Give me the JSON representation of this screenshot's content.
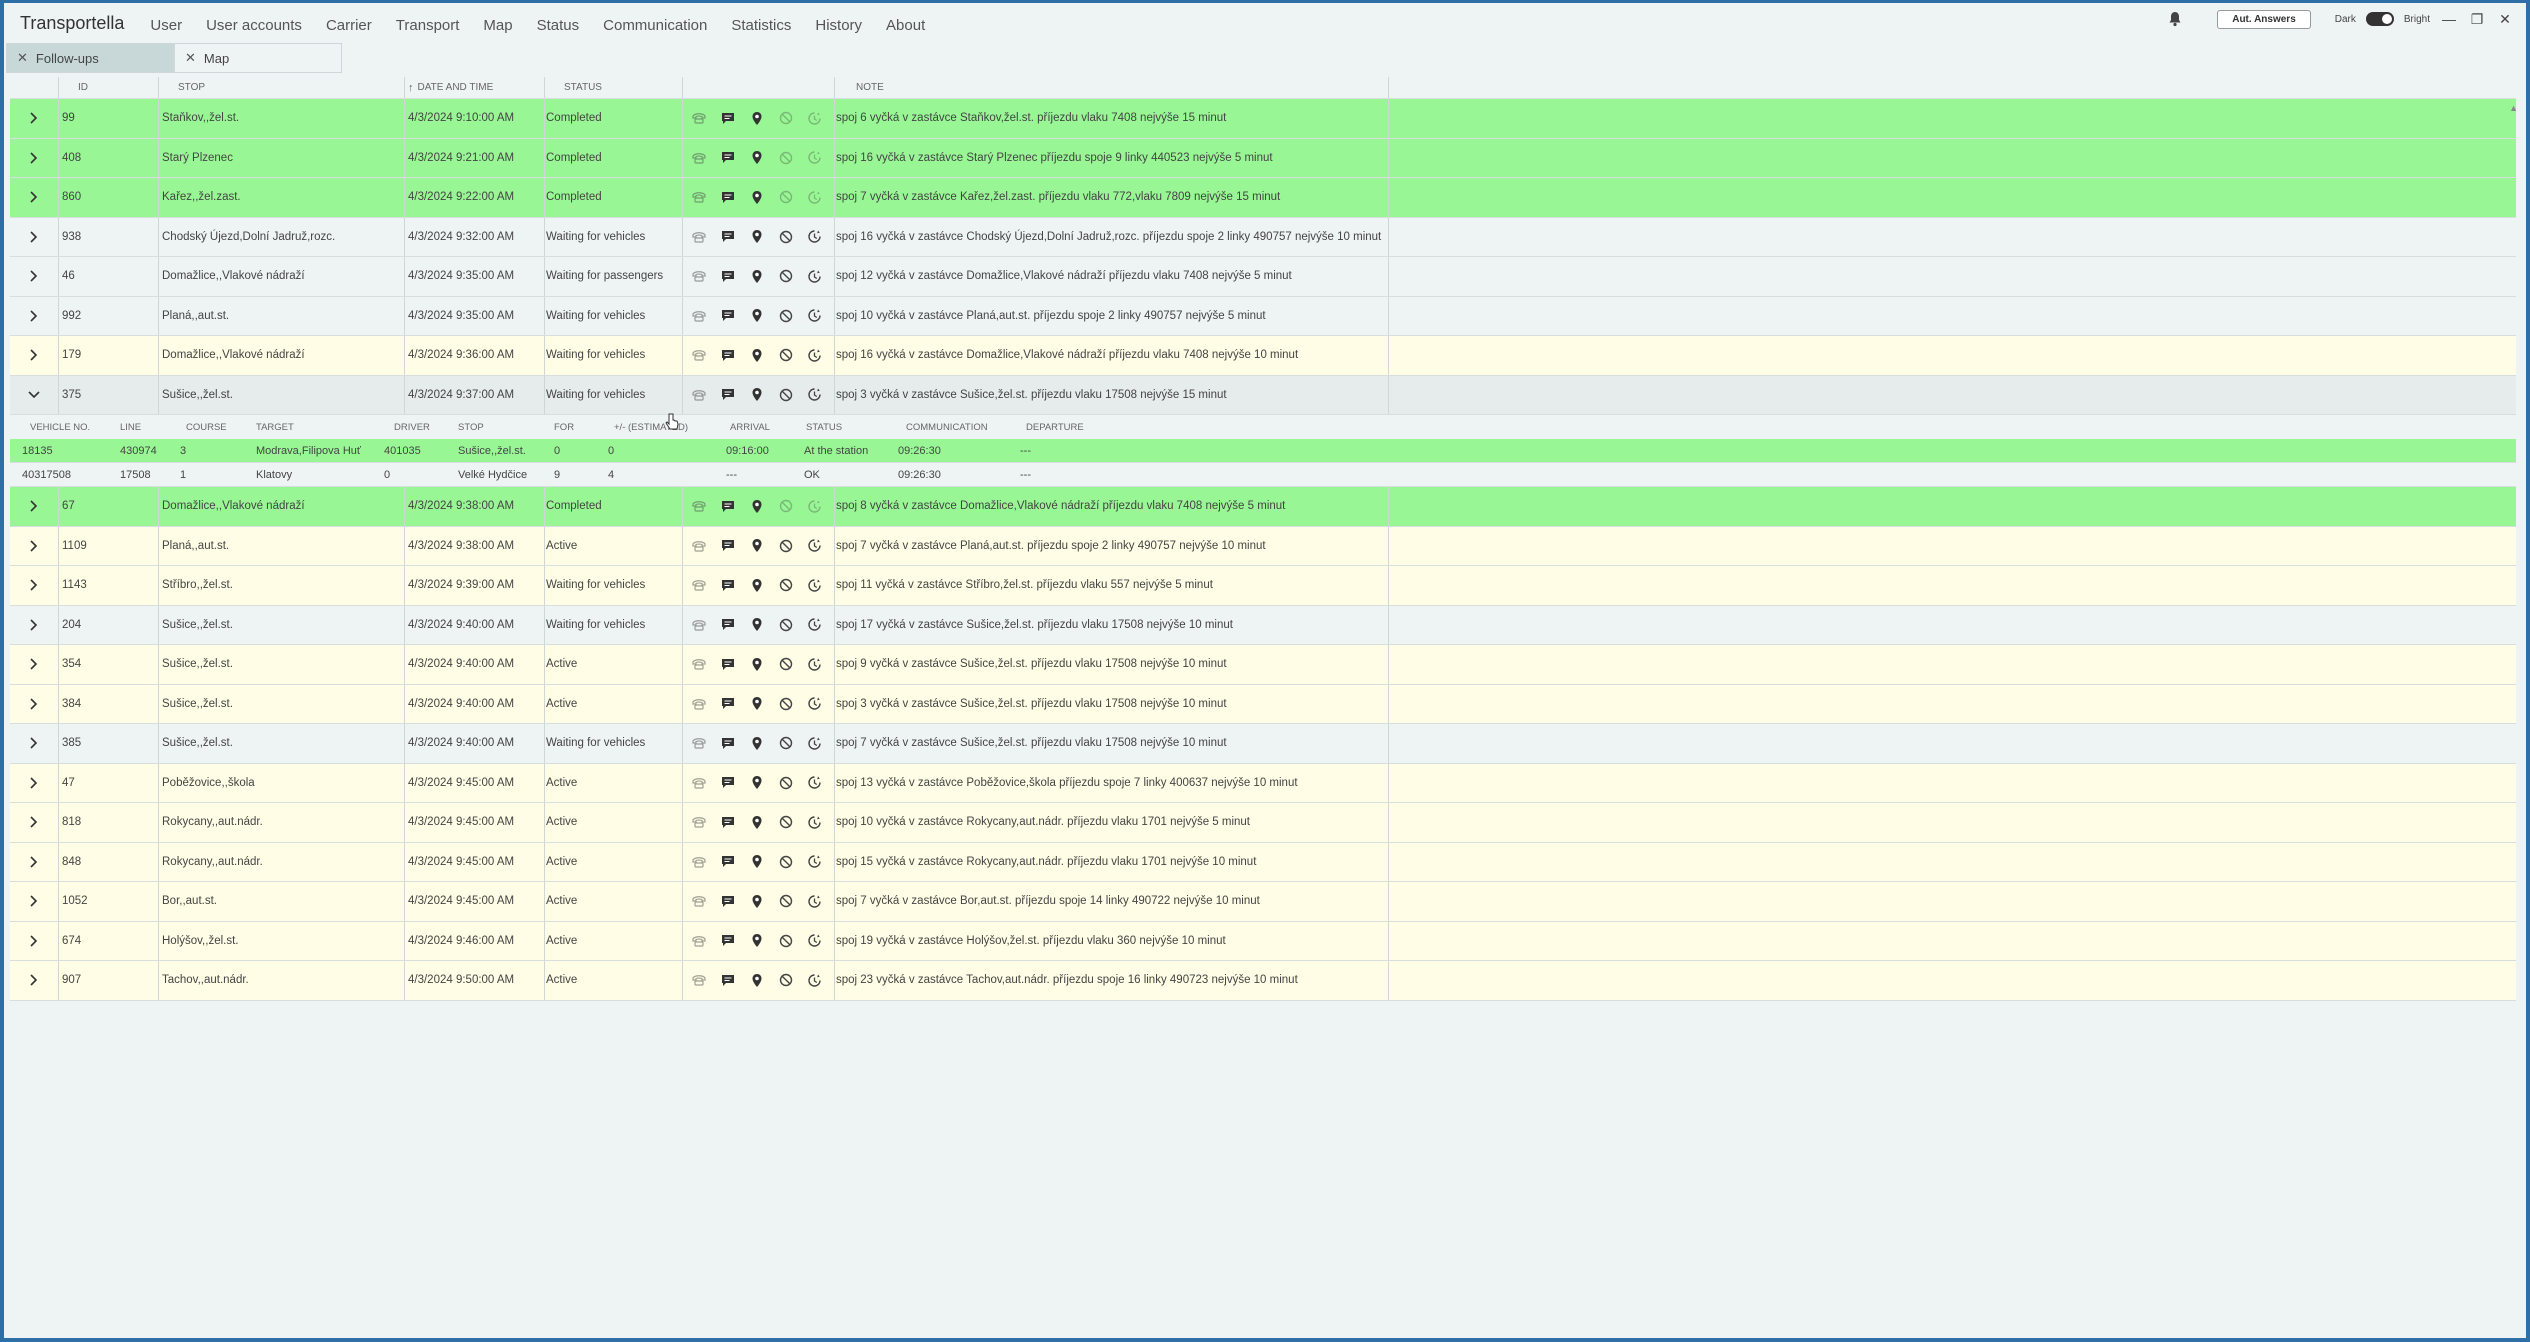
{
  "app": {
    "title": "Transportella",
    "menu": [
      "User",
      "User accounts",
      "Carrier",
      "Transport",
      "Map",
      "Status",
      "Communication",
      "Statistics",
      "History",
      "About"
    ],
    "aut_answers": "Aut. Answers",
    "theme_dark": "Dark",
    "theme_bright": "Bright"
  },
  "tabs": [
    {
      "label": "Follow-ups",
      "active": true
    },
    {
      "label": "Map",
      "active": false
    }
  ],
  "columns": {
    "id": "ID",
    "stop": "STOP",
    "datetime": "DATE AND TIME",
    "status": "STATUS",
    "note": "NOTE"
  },
  "rows": [
    {
      "id": "99",
      "stop": "Staňkov,,žel.st.",
      "datetime": "4/3/2024 9:10:00 AM",
      "status": "Completed",
      "note": "spoj 6 vyčká v zastávce Staňkov,žel.st. příjezdu vlaku 7408 nejvýše 15 minut",
      "color": "green"
    },
    {
      "id": "408",
      "stop": "Starý Plzenec",
      "datetime": "4/3/2024 9:21:00 AM",
      "status": "Completed",
      "note": "spoj 16 vyčká v zastávce Starý Plzenec příjezdu spoje 9 linky 440523 nejvýše 5 minut",
      "color": "green"
    },
    {
      "id": "860",
      "stop": "Kařez,,žel.zast.",
      "datetime": "4/3/2024 9:22:00 AM",
      "status": "Completed",
      "note": "spoj 7 vyčká v zastávce Kařez,žel.zast. příjezdu vlaku 772,vlaku 7809 nejvýše 15 minut",
      "color": "green"
    },
    {
      "id": "938",
      "stop": "Chodský Újezd,Dolní Jadruž,rozc.",
      "datetime": "4/3/2024 9:32:00 AM",
      "status": "Waiting for vehicles",
      "note": "spoj 16 vyčká v zastávce Chodský Újezd,Dolní Jadruž,rozc. příjezdu spoje 2 linky 490757 nejvýše 10 minut",
      "color": "grey"
    },
    {
      "id": "46",
      "stop": "Domažlice,,Vlakové nádraží",
      "datetime": "4/3/2024 9:35:00 AM",
      "status": "Waiting for passengers",
      "note": "spoj 12 vyčká v zastávce Domažlice,Vlakové nádraží příjezdu vlaku 7408 nejvýše 5 minut",
      "color": "grey"
    },
    {
      "id": "992",
      "stop": "Planá,,aut.st.",
      "datetime": "4/3/2024 9:35:00 AM",
      "status": "Waiting for vehicles",
      "note": "spoj 10 vyčká v zastávce Planá,aut.st. příjezdu spoje 2 linky 490757 nejvýše 5 minut",
      "color": "grey"
    },
    {
      "id": "179",
      "stop": "Domažlice,,Vlakové nádraží",
      "datetime": "4/3/2024 9:36:00 AM",
      "status": "Waiting for vehicles",
      "note": "spoj 16 vyčká v zastávce Domažlice,Vlakové nádraží příjezdu vlaku 7408 nejvýše 10 minut",
      "color": "yellow"
    },
    {
      "id": "375",
      "stop": "Sušice,,žel.st.",
      "datetime": "4/3/2024 9:37:00 AM",
      "status": "Waiting for vehicles",
      "note": "spoj 3 vyčká v zastávce Sušice,žel.st. příjezdu vlaku 17508 nejvýše 15 minut",
      "color": "expanded",
      "expanded": true
    }
  ],
  "sub_table": {
    "headers": [
      "VEHICLE NO.",
      "LINE",
      "COURSE",
      "TARGET",
      "DRIVER",
      "STOP",
      "FOR",
      "+/- (ESTIMATED)",
      "ARRIVAL",
      "STATUS",
      "COMMUNICATION",
      "DEPARTURE"
    ],
    "rows": [
      {
        "cells": [
          "18135",
          "430974",
          "3",
          "Modrava,Filipova Huť",
          "401035",
          "Sušice,,žel.st.",
          "0",
          "0",
          "09:16:00",
          "At the station",
          "09:26:30",
          "---"
        ],
        "color": "green"
      },
      {
        "cells": [
          "40317508",
          "17508",
          "1",
          "Klatovy",
          "0",
          "Velké Hydčice",
          "9",
          "4",
          "---",
          "OK",
          "09:26:30",
          "---"
        ],
        "color": "grey"
      }
    ]
  },
  "rows_after": [
    {
      "id": "67",
      "stop": "Domažlice,,Vlakové nádraží",
      "datetime": "4/3/2024 9:38:00 AM",
      "status": "Completed",
      "note": "spoj 8 vyčká v zastávce Domažlice,Vlakové nádraží příjezdu vlaku 7408 nejvýše 5 minut",
      "color": "green"
    },
    {
      "id": "1109",
      "stop": "Planá,,aut.st.",
      "datetime": "4/3/2024 9:38:00 AM",
      "status": "Active",
      "note": "spoj 7 vyčká v zastávce Planá,aut.st. příjezdu spoje 2 linky 490757 nejvýše 10 minut",
      "color": "yellow"
    },
    {
      "id": "1143",
      "stop": "Stříbro,,žel.st.",
      "datetime": "4/3/2024 9:39:00 AM",
      "status": "Waiting for vehicles",
      "note": "spoj 11 vyčká v zastávce Stříbro,žel.st. příjezdu vlaku 557 nejvýše 5 minut",
      "color": "yellow"
    },
    {
      "id": "204",
      "stop": "Sušice,,žel.st.",
      "datetime": "4/3/2024 9:40:00 AM",
      "status": "Waiting for vehicles",
      "note": "spoj 17 vyčká v zastávce Sušice,žel.st. příjezdu vlaku 17508 nejvýše 10 minut",
      "color": "grey"
    },
    {
      "id": "354",
      "stop": "Sušice,,žel.st.",
      "datetime": "4/3/2024 9:40:00 AM",
      "status": "Active",
      "note": "spoj 9 vyčká v zastávce Sušice,žel.st. příjezdu vlaku 17508 nejvýše 10 minut",
      "color": "yellow"
    },
    {
      "id": "384",
      "stop": "Sušice,,žel.st.",
      "datetime": "4/3/2024 9:40:00 AM",
      "status": "Active",
      "note": "spoj 3 vyčká v zastávce Sušice,žel.st. příjezdu vlaku 17508 nejvýše 10 minut",
      "color": "yellow"
    },
    {
      "id": "385",
      "stop": "Sušice,,žel.st.",
      "datetime": "4/3/2024 9:40:00 AM",
      "status": "Waiting for vehicles",
      "note": "spoj 7 vyčká v zastávce Sušice,žel.st. příjezdu vlaku 17508 nejvýše 10 minut",
      "color": "grey"
    },
    {
      "id": "47",
      "stop": "Poběžovice,,škola",
      "datetime": "4/3/2024 9:45:00 AM",
      "status": "Active",
      "note": "spoj 13 vyčká v zastávce Poběžovice,škola příjezdu spoje 7 linky 400637 nejvýše 10 minut",
      "color": "yellow"
    },
    {
      "id": "818",
      "stop": "Rokycany,,aut.nádr.",
      "datetime": "4/3/2024 9:45:00 AM",
      "status": "Active",
      "note": "spoj 10 vyčká v zastávce Rokycany,aut.nádr. příjezdu vlaku 1701 nejvýše 5 minut",
      "color": "yellow"
    },
    {
      "id": "848",
      "stop": "Rokycany,,aut.nádr.",
      "datetime": "4/3/2024 9:45:00 AM",
      "status": "Active",
      "note": "spoj 15 vyčká v zastávce Rokycany,aut.nádr. příjezdu vlaku 1701 nejvýše 10 minut",
      "color": "yellow"
    },
    {
      "id": "1052",
      "stop": "Bor,,aut.st.",
      "datetime": "4/3/2024 9:45:00 AM",
      "status": "Active",
      "note": "spoj 7 vyčká v zastávce Bor,aut.st. příjezdu spoje 14 linky 490722 nejvýše 10 minut",
      "color": "yellow"
    },
    {
      "id": "674",
      "stop": "Holýšov,,žel.st.",
      "datetime": "4/3/2024 9:46:00 AM",
      "status": "Active",
      "note": "spoj 19 vyčká v zastávce Holýšov,žel.st. příjezdu vlaku 360 nejvýše 10 minut",
      "color": "yellow"
    },
    {
      "id": "907",
      "stop": "Tachov,,aut.nádr.",
      "datetime": "4/3/2024 9:50:00 AM",
      "status": "Active",
      "note": "spoj 23 vyčká v zastávce Tachov,aut.nádr. příjezdu spoje 16 linky 490723 nejvýše 10 minut",
      "color": "yellow"
    }
  ]
}
